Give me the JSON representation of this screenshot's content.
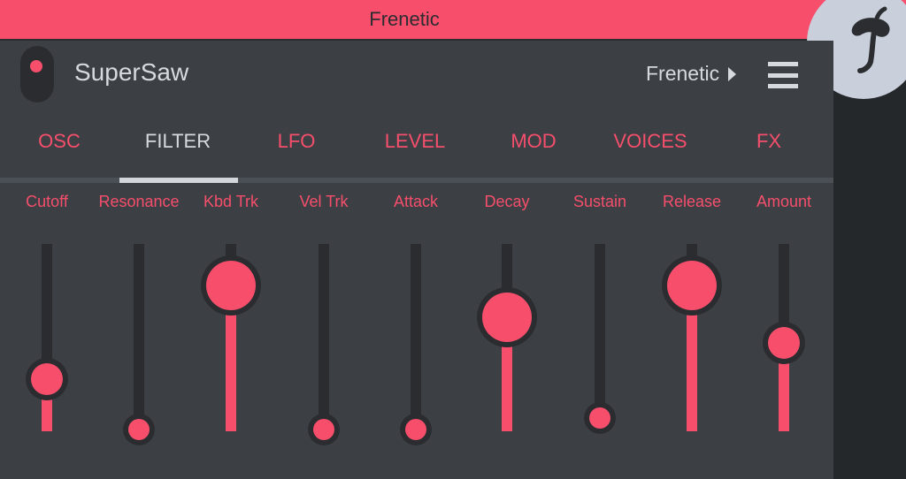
{
  "app": {
    "title": "Frenetic"
  },
  "header": {
    "patch_name": "SuperSaw",
    "preset_name": "Frenetic"
  },
  "tabs": [
    {
      "label": "OSC",
      "active": false
    },
    {
      "label": "FILTER",
      "active": true
    },
    {
      "label": "LFO",
      "active": false
    },
    {
      "label": "LEVEL",
      "active": false
    },
    {
      "label": "MOD",
      "active": false
    },
    {
      "label": "VOICES",
      "active": false
    },
    {
      "label": "FX",
      "active": false
    }
  ],
  "sliders": [
    {
      "label": "Cutoff",
      "value": 0.35
    },
    {
      "label": "Resonance",
      "value": 0.0
    },
    {
      "label": "Kbd Trk",
      "value": 1.0
    },
    {
      "label": "Vel Trk",
      "value": 0.0
    },
    {
      "label": "Attack",
      "value": 0.0
    },
    {
      "label": "Decay",
      "value": 0.78
    },
    {
      "label": "Sustain",
      "value": 0.08
    },
    {
      "label": "Release",
      "value": 1.0
    },
    {
      "label": "Amount",
      "value": 0.6
    }
  ],
  "colors": {
    "accent": "#f64e6b",
    "panel": "#3c4045",
    "track": "#2a2c30",
    "text": "#d6d9de"
  }
}
